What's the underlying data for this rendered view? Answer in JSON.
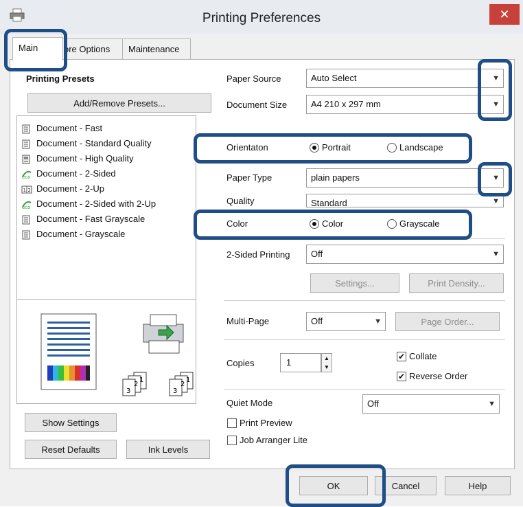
{
  "window": {
    "title": "Printing Preferences",
    "close_label": "✕"
  },
  "tabs": [
    "Main",
    "ore Options",
    "Maintenance"
  ],
  "presets": {
    "heading": "Printing Presets",
    "add_remove_label": "Add/Remove Presets...",
    "items": [
      {
        "label": "Document - Fast",
        "icon": "document-icon"
      },
      {
        "label": "Document - Standard Quality",
        "icon": "document-icon"
      },
      {
        "label": "Document - High Quality",
        "icon": "document-high-icon"
      },
      {
        "label": "Document - 2-Sided",
        "icon": "eco-icon"
      },
      {
        "label": "Document - 2-Up",
        "icon": "two-up-icon"
      },
      {
        "label": "Document - 2-Sided with 2-Up",
        "icon": "eco-icon"
      },
      {
        "label": "Document - Fast Grayscale",
        "icon": "document-icon"
      },
      {
        "label": "Document - Grayscale",
        "icon": "document-icon"
      }
    ]
  },
  "preview": {
    "order_small_labels": [
      "3",
      "2",
      "1"
    ]
  },
  "left_buttons": {
    "show_settings": "Show Settings",
    "reset_defaults": "Reset Defaults",
    "ink_levels": "Ink Levels"
  },
  "settings": {
    "paper_source": {
      "label": "Paper Source",
      "value": "Auto Select"
    },
    "document_size": {
      "label": "Document Size",
      "value": "A4 210 x 297 mm"
    },
    "orientation": {
      "label": "Orientaton",
      "options": [
        "Portrait",
        "Landscape"
      ],
      "selected": "Portrait"
    },
    "paper_type": {
      "label": "Paper Type",
      "value": "plain papers"
    },
    "quality": {
      "label": "Quality",
      "value": "Standard"
    },
    "color": {
      "label": "Color",
      "options": [
        "Color",
        "Grayscale"
      ],
      "selected": "Color"
    },
    "two_sided": {
      "label": "2-Sided Printing",
      "value": "Off"
    },
    "settings_button": "Settings...",
    "print_density_button": "Print Density...",
    "multi_page": {
      "label": "Multi-Page",
      "value": "Off"
    },
    "page_order_button": "Page Order...",
    "copies": {
      "label": "Copies",
      "value": "1"
    },
    "collate": {
      "label": "Collate",
      "checked": true
    },
    "reverse_order": {
      "label": "Reverse Order",
      "checked": true
    },
    "quiet_mode": {
      "label": "Quiet Mode",
      "value": "Off"
    },
    "print_preview": {
      "label": "Print Preview",
      "checked": false
    },
    "job_arranger": {
      "label": "Job Arranger Lite",
      "checked": false
    }
  },
  "footer": {
    "ok": "OK",
    "cancel": "Cancel",
    "help": "Help"
  },
  "colors": {
    "highlight": "#1f4d86",
    "close_button": "#c7413a",
    "title_bar": "#e8ecf1"
  }
}
